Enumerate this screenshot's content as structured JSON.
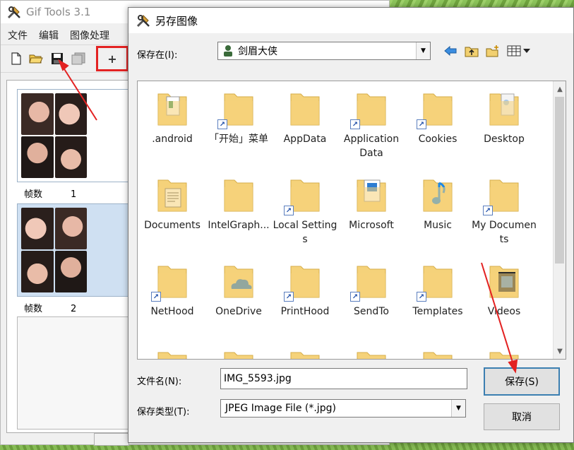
{
  "main_window": {
    "title": "Gif Tools 3.1",
    "menu": [
      "文件",
      "编辑",
      "图像处理"
    ],
    "toolbar": {
      "add_label": "+"
    },
    "frames": [
      {
        "label": "帧数",
        "number": "1"
      },
      {
        "label": "帧数",
        "number": "2"
      }
    ]
  },
  "dialog": {
    "title": "另存图像",
    "save_in_label": "保存在(I):",
    "save_in_value": "剑眉大侠",
    "files": [
      {
        "name": ".android",
        "icon": "folder-doc-icon",
        "shortcut": false
      },
      {
        "name": "「开始」菜单",
        "icon": "folder-icon",
        "shortcut": true
      },
      {
        "name": "AppData",
        "icon": "folder-icon",
        "shortcut": false
      },
      {
        "name": "Application Data",
        "icon": "folder-icon",
        "shortcut": true
      },
      {
        "name": "Cookies",
        "icon": "folder-icon",
        "shortcut": true
      },
      {
        "name": "Desktop",
        "icon": "folder-desktop-icon",
        "shortcut": false
      },
      {
        "name": "Documents",
        "icon": "folder-documents-icon",
        "shortcut": false
      },
      {
        "name": "IntelGraph...",
        "icon": "folder-icon",
        "shortcut": false
      },
      {
        "name": "Local Settings",
        "icon": "folder-icon",
        "shortcut": true
      },
      {
        "name": "Microsoft",
        "icon": "folder-microsoft-icon",
        "shortcut": false
      },
      {
        "name": "Music",
        "icon": "folder-music-icon",
        "shortcut": false
      },
      {
        "name": "My Documents",
        "icon": "folder-icon",
        "shortcut": true
      },
      {
        "name": "NetHood",
        "icon": "folder-icon",
        "shortcut": true
      },
      {
        "name": "OneDrive",
        "icon": "onedrive-folder-icon",
        "shortcut": false
      },
      {
        "name": "PrintHood",
        "icon": "folder-icon",
        "shortcut": true
      },
      {
        "name": "SendTo",
        "icon": "folder-icon",
        "shortcut": true
      },
      {
        "name": "Templates",
        "icon": "folder-icon",
        "shortcut": true
      },
      {
        "name": "Videos",
        "icon": "folder-videos-icon",
        "shortcut": false
      }
    ],
    "filename_label": "文件名(N):",
    "filename_value": "IMG_5593.jpg",
    "filetype_label": "保存类型(T):",
    "filetype_value": "JPEG Image File (*.jpg)",
    "save_button": "保存(S)",
    "cancel_button": "取消"
  },
  "colors": {
    "annotation_red": "#e32222",
    "folder_yellow": "#f5d27a",
    "default_button_border": "#3c7fb1"
  }
}
